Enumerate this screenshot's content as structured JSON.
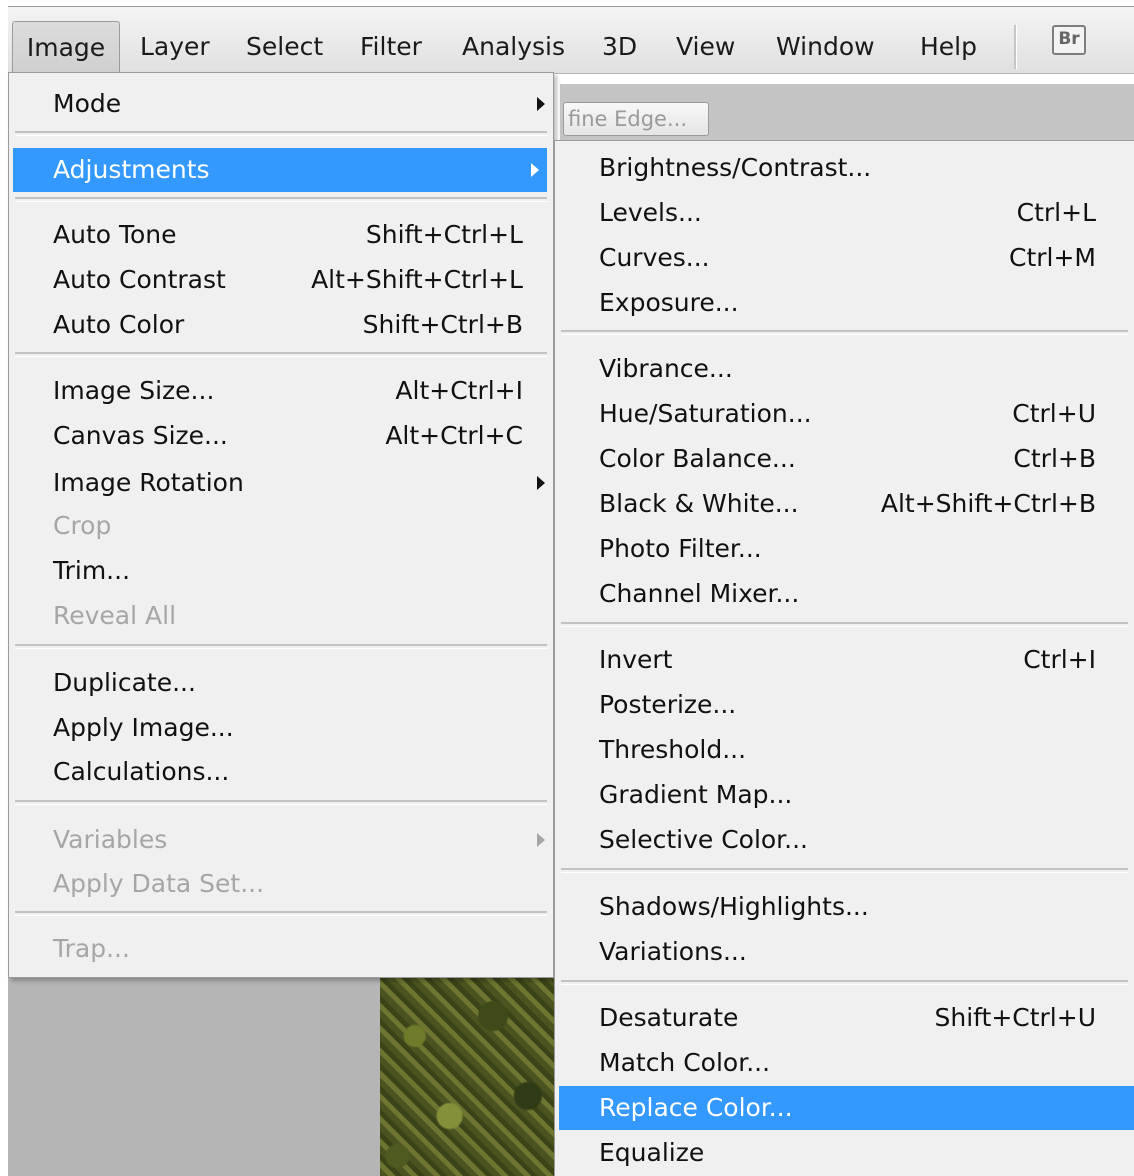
{
  "menubar": {
    "items": [
      "Image",
      "Layer",
      "Select",
      "Filter",
      "Analysis",
      "3D",
      "View",
      "Window",
      "Help"
    ],
    "bridge_label": "Br"
  },
  "options_bar": {
    "refine_edge_label": "fine Edge..."
  },
  "image_menu": {
    "mode": "Mode",
    "adjustments": "Adjustments",
    "auto_tone": "Auto Tone",
    "auto_tone_sc": "Shift+Ctrl+L",
    "auto_contrast": "Auto Contrast",
    "auto_contrast_sc": "Alt+Shift+Ctrl+L",
    "auto_color": "Auto Color",
    "auto_color_sc": "Shift+Ctrl+B",
    "image_size": "Image Size...",
    "image_size_sc": "Alt+Ctrl+I",
    "canvas_size": "Canvas Size...",
    "canvas_size_sc": "Alt+Ctrl+C",
    "image_rotation": "Image Rotation",
    "crop": "Crop",
    "trim": "Trim...",
    "reveal_all": "Reveal All",
    "duplicate": "Duplicate...",
    "apply_image": "Apply Image...",
    "calculations": "Calculations...",
    "variables": "Variables",
    "apply_data_set": "Apply Data Set...",
    "trap": "Trap..."
  },
  "adjustments_menu": {
    "brightness": "Brightness/Contrast...",
    "levels": "Levels...",
    "levels_sc": "Ctrl+L",
    "curves": "Curves...",
    "curves_sc": "Ctrl+M",
    "exposure": "Exposure...",
    "vibrance": "Vibrance...",
    "hue": "Hue/Saturation...",
    "hue_sc": "Ctrl+U",
    "color_balance": "Color Balance...",
    "color_balance_sc": "Ctrl+B",
    "bw": "Black & White...",
    "bw_sc": "Alt+Shift+Ctrl+B",
    "photo_filter": "Photo Filter...",
    "channel_mixer": "Channel Mixer...",
    "invert": "Invert",
    "invert_sc": "Ctrl+I",
    "posterize": "Posterize...",
    "threshold": "Threshold...",
    "gradient_map": "Gradient Map...",
    "selective_color": "Selective Color...",
    "shadows": "Shadows/Highlights...",
    "variations": "Variations...",
    "desaturate": "Desaturate",
    "desaturate_sc": "Shift+Ctrl+U",
    "match_color": "Match Color...",
    "replace_color": "Replace Color...",
    "equalize": "Equalize"
  },
  "colors": {
    "highlight": "#3399ff",
    "menu_bg": "#f0f0f0",
    "disabled_text": "#a6a6a6"
  }
}
